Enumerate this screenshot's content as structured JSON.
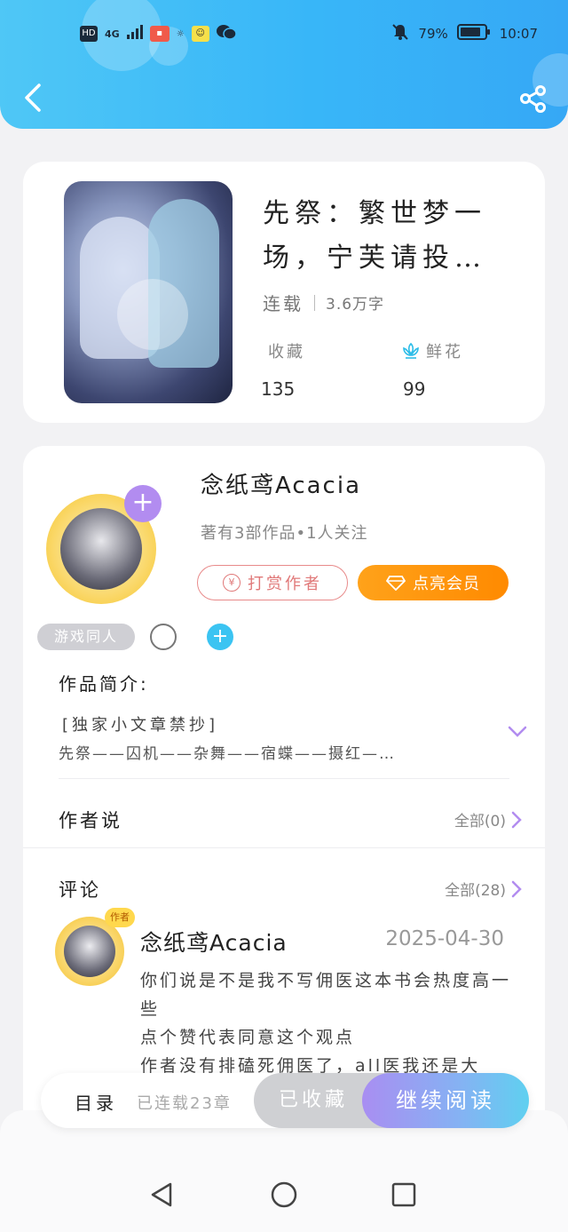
{
  "status_bar": {
    "left_labels": [
      "HD",
      "4G"
    ],
    "battery": "79%",
    "time": "10:07"
  },
  "book": {
    "title": "先祭：繁世梦一场，宁芙请投…",
    "status": "连载",
    "word_count": "3.6万字",
    "favorites_label": "收藏",
    "favorites_count": "135",
    "flowers_label": "鲜花",
    "flowers_count": "99"
  },
  "author": {
    "name": "念纸鸢Acacia",
    "meta": "著有3部作品•1人关注",
    "tip_button": "打赏作者",
    "tip_symbol": "¥",
    "vip_button": "点亮会员",
    "tag": "游戏同人",
    "plus": "+"
  },
  "intro": {
    "title": "作品简介:",
    "line1": "[独家小文章禁抄]",
    "line2": "先祭——囚机——杂舞——宿蝶——摄红—…"
  },
  "author_says": {
    "title": "作者说",
    "more": "全部(0)"
  },
  "comments": {
    "title": "评论",
    "more": "全部(28)",
    "items": [
      {
        "name": "念纸鸢Acacia",
        "badge": "作者",
        "date": "2025-04-30",
        "text": "你们说是不是我不写佣医这本书会热度高一些\n点个赞代表同意这个观点\n作者没有排磕死佣医了，all医我还是大"
      }
    ]
  },
  "actions": {
    "toc": "目录",
    "chapters": "已连载23章",
    "favorited": "已收藏",
    "continue": "继续阅读"
  },
  "colors": {
    "header_start": "#4fc7f6",
    "header_end": "#36a8f5",
    "vip_orange": "#ff8a00",
    "tip_red": "#e07878",
    "accent_purple": "#b28cf0",
    "read_gradient_end": "#5fd0f0"
  },
  "icons": [
    "back-arrow-icon",
    "share-icon",
    "flower-icon",
    "chevron-down-icon",
    "chevron-right-icon",
    "diamond-icon",
    "nav-back-icon",
    "nav-home-icon",
    "nav-recent-icon"
  ]
}
